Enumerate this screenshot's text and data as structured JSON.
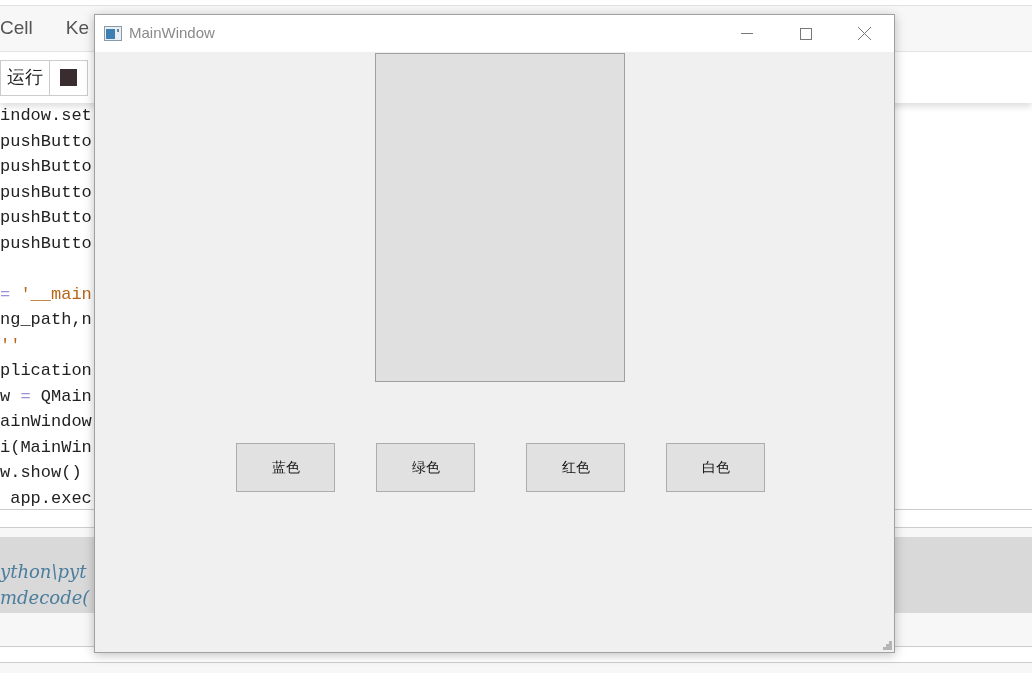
{
  "notebook": {
    "menu": [
      "Cell",
      "Ke"
    ],
    "toolbar": {
      "run_label": "运行"
    },
    "code_lines": [
      {
        "kind": "code",
        "segments": [
          {
            "kind": "plain",
            "text": "indow.set"
          }
        ]
      },
      {
        "kind": "code",
        "segments": [
          {
            "kind": "plain",
            "text": "pushButto"
          }
        ]
      },
      {
        "kind": "code",
        "segments": [
          {
            "kind": "plain",
            "text": "pushButto"
          }
        ]
      },
      {
        "kind": "code",
        "segments": [
          {
            "kind": "plain",
            "text": "pushButto"
          }
        ]
      },
      {
        "kind": "code",
        "segments": [
          {
            "kind": "plain",
            "text": "pushButto"
          }
        ]
      },
      {
        "kind": "code",
        "segments": [
          {
            "kind": "plain",
            "text": "pushButto"
          }
        ]
      },
      {
        "kind": "blank"
      },
      {
        "kind": "code",
        "segments": [
          {
            "kind": "operator",
            "text": "="
          },
          {
            "kind": "string",
            "text": " '__main"
          }
        ]
      },
      {
        "kind": "code",
        "segments": [
          {
            "kind": "plain",
            "text": "ng_path,n"
          }
        ]
      },
      {
        "kind": "code",
        "segments": [
          {
            "kind": "string",
            "text": "''"
          }
        ]
      },
      {
        "kind": "code",
        "segments": [
          {
            "kind": "plain",
            "text": "plication"
          }
        ]
      },
      {
        "kind": "code",
        "segments": [
          {
            "kind": "plain",
            "text": "w "
          },
          {
            "kind": "operator",
            "text": "="
          },
          {
            "kind": "plain",
            "text": " QMain"
          }
        ]
      },
      {
        "kind": "code",
        "segments": [
          {
            "kind": "plain",
            "text": "ainWindow"
          }
        ]
      },
      {
        "kind": "code",
        "segments": [
          {
            "kind": "plain",
            "text": "i(MainWin"
          }
        ]
      },
      {
        "kind": "code",
        "segments": [
          {
            "kind": "plain",
            "text": "w.show()"
          }
        ]
      },
      {
        "kind": "code",
        "segments": [
          {
            "kind": "plain",
            "text": " app.exec"
          }
        ]
      }
    ],
    "output_lines": [
      "ython\\pyt",
      "mdecode("
    ]
  },
  "window": {
    "title": "MainWindow",
    "buttons": [
      {
        "label": "蓝色"
      },
      {
        "label": "绿色"
      },
      {
        "label": "红色"
      },
      {
        "label": "白色"
      }
    ]
  }
}
